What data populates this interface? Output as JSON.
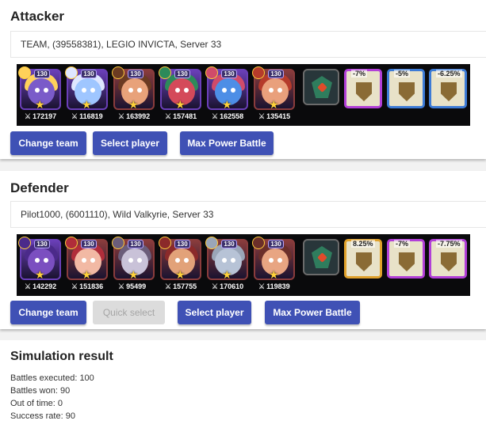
{
  "attacker": {
    "title": "Attacker",
    "info": "TEAM, (39558381), LEGIO INVICTA, Server 33",
    "heroes": [
      {
        "level": "130",
        "power": "172197",
        "frame": "#6a3fb8",
        "skin": "#7a5bc9",
        "hair": "#ffd15a"
      },
      {
        "level": "130",
        "power": "116819",
        "frame": "#6a3fb8",
        "skin": "#9fc6ff",
        "hair": "#dfe7ff"
      },
      {
        "level": "130",
        "power": "163992",
        "frame": "#8a3c3c",
        "skin": "#e8a27a",
        "hair": "#6b3b22"
      },
      {
        "level": "130",
        "power": "157481",
        "frame": "#6a3fb8",
        "skin": "#d44a5a",
        "hair": "#2d8a5a"
      },
      {
        "level": "130",
        "power": "162558",
        "frame": "#6a3fb8",
        "skin": "#4d8ee6",
        "hair": "#d04b6a"
      },
      {
        "level": "130",
        "power": "135415",
        "frame": "#8a3c3c",
        "skin": "#e9a07c",
        "hair": "#b53b2b"
      }
    ],
    "totems": [
      {
        "pct": "-7%",
        "border": "#b23fd8"
      },
      {
        "pct": "-5%",
        "border": "#3d7bd6"
      },
      {
        "pct": "-6.25%",
        "border": "#3d7bd6"
      }
    ],
    "buttons": {
      "change_team": "Change team",
      "select_player": "Select player",
      "max_power": "Max Power Battle"
    }
  },
  "defender": {
    "title": "Defender",
    "info": "Pilot1000, (6001110), Wild Valkyrie, Server 33",
    "heroes": [
      {
        "level": "130",
        "power": "142292",
        "frame": "#6a3fb8",
        "skin": "#7b4fc0",
        "hair": "#4b2a8a"
      },
      {
        "level": "130",
        "power": "151836",
        "frame": "#8a3c3c",
        "skin": "#f2b9a4",
        "hair": "#b02d3a"
      },
      {
        "level": "130",
        "power": "95499",
        "frame": "#8a3c3c",
        "skin": "#c9c2d8",
        "hair": "#6b5d7a"
      },
      {
        "level": "130",
        "power": "157755",
        "frame": "#8a3c3c",
        "skin": "#e2a279",
        "hair": "#8b2a2a"
      },
      {
        "level": "130",
        "power": "170610",
        "frame": "#8a3c3c",
        "skin": "#b7c3d6",
        "hair": "#9aa6b8"
      },
      {
        "level": "130",
        "power": "119839",
        "frame": "#8a3c3c",
        "skin": "#e8a582",
        "hair": "#6b2f2a"
      }
    ],
    "totems": [
      {
        "pct": "8.25%",
        "border": "#e0a12b"
      },
      {
        "pct": "-7%",
        "border": "#b23fd8"
      },
      {
        "pct": "-7.75%",
        "border": "#b23fd8"
      }
    ],
    "buttons": {
      "change_team": "Change team",
      "quick_select": "Quick select",
      "select_player": "Select player",
      "max_power": "Max Power Battle"
    }
  },
  "result": {
    "title": "Simulation result",
    "battles_executed": "Battles executed: 100",
    "battles_won": "Battles won: 90",
    "out_of_time": "Out of time: 0",
    "success_rate": "Success rate: 90"
  },
  "colors": {
    "primary_button": "#3f51b5",
    "disabled_button": "#dcdcdc",
    "strip_background": "#0a0a0c"
  }
}
